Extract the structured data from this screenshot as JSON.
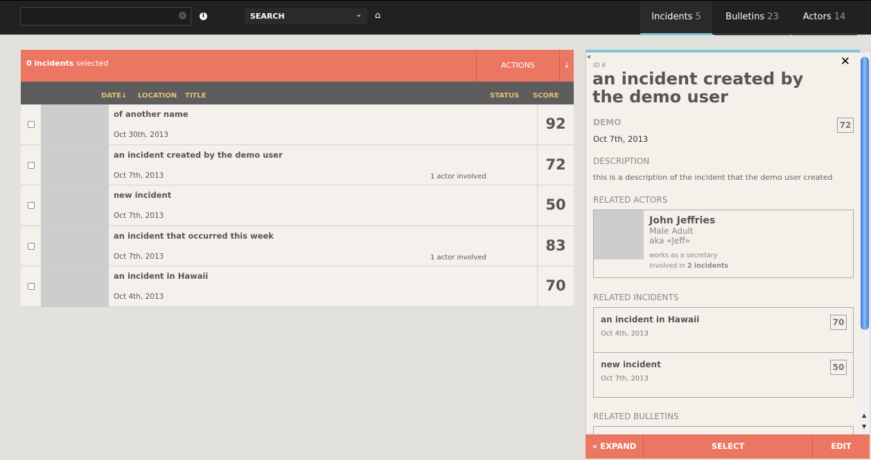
{
  "topbar": {
    "search_value": "",
    "search_type": "SEARCH",
    "tabs": [
      {
        "label": "Incidents",
        "count": "5"
      },
      {
        "label": "Bulletins",
        "count": "23"
      },
      {
        "label": "Actors",
        "count": "14"
      }
    ]
  },
  "list": {
    "selected_count": "0 incidents",
    "selected_suffix": "selected",
    "actions_label": "ACTIONS",
    "columns": {
      "date": "DATE",
      "location": "LOCATION",
      "title": "TITLE",
      "status": "STATUS",
      "score": "SCORE"
    },
    "rows": [
      {
        "title": "of another name",
        "date": "Oct 30th, 2013",
        "actors": "",
        "score": "92"
      },
      {
        "title": "an incident created by the demo user",
        "date": "Oct 7th, 2013",
        "actors": "1 actor involved",
        "score": "72"
      },
      {
        "title": "new incident",
        "date": "Oct 7th, 2013",
        "actors": "",
        "score": "50"
      },
      {
        "title": "an incident that occurred this week",
        "date": "Oct 7th, 2013",
        "actors": "1 actor involved",
        "score": "83"
      },
      {
        "title": "an incident in Hawaii",
        "date": "Oct 4th, 2013",
        "actors": "",
        "score": "70"
      }
    ]
  },
  "detail": {
    "collapse": "«",
    "id": "ID 6",
    "title": "an incident created by the demo user",
    "label": "DEMO",
    "date": "Oct 7th, 2013",
    "score": "72",
    "description_label": "DESCRIPTION",
    "description": "this is a description of the incident that the demo user created",
    "related_actors_label": "RELATED ACTORS",
    "actor": {
      "name": "John Jeffries",
      "desc": "Male Adult",
      "aka": "aka «Jeff»",
      "occupation": "works as a secretary",
      "involved_prefix": "involved in",
      "involved": "2 incidents"
    },
    "related_incidents_label": "RELATED INCIDENTS",
    "related_incidents": [
      {
        "title": "an incident in Hawaii",
        "date": "Oct 4th, 2013",
        "score": "70"
      },
      {
        "title": "new incident",
        "date": "Oct 7th, 2013",
        "score": "50"
      }
    ],
    "related_bulletins_label": "RELATED BULLETINS",
    "buttons": {
      "expand": "« EXPAND",
      "select": "SELECT",
      "edit": "EDIT"
    }
  }
}
